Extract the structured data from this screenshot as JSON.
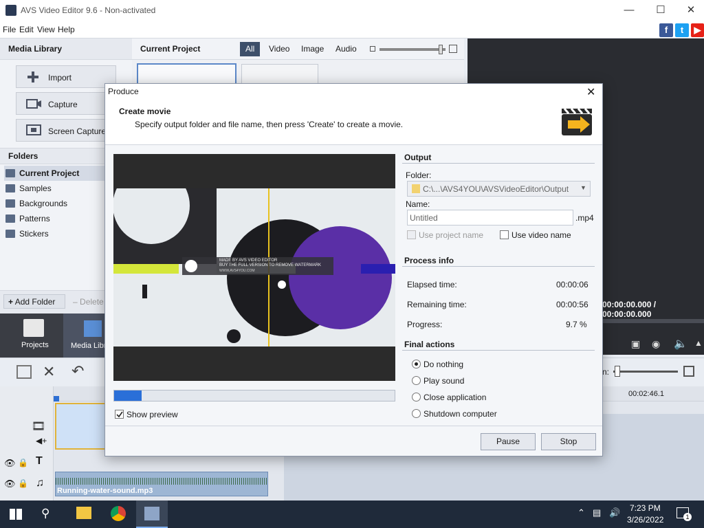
{
  "window": {
    "title": "AVS Video Editor 9.6 - Non-activated"
  },
  "menu": [
    "File",
    "Edit",
    "View",
    "Help"
  ],
  "left": {
    "media_library": "Media Library",
    "import": "Import",
    "capture": "Capture",
    "screen_capture": "Screen Capture",
    "folders": "Folders",
    "folder_items": [
      "Current Project",
      "Samples",
      "Backgrounds",
      "Patterns",
      "Stickers"
    ],
    "add_folder": "Add Folder",
    "delete": "Delete"
  },
  "center": {
    "title": "Current Project",
    "filters": [
      "All",
      "Video",
      "Image",
      "Audio"
    ]
  },
  "nav": {
    "projects": "Projects",
    "media_library": "Media Libr"
  },
  "player": {
    "time": "00:00:00.000 / 00:00:00.000",
    "zoom_label": "n:",
    "timeline_time": "00:02:46.1"
  },
  "timeline": {
    "audio_clip": "Running-water-sound.mp3"
  },
  "taskbar": {
    "time": "7:23 PM",
    "date": "3/26/2022",
    "notif_count": "1"
  },
  "dialog": {
    "title": "Produce",
    "header_title": "Create movie",
    "header_desc": "Specify output folder and file name, then press 'Create' to create a movie.",
    "progress_value": 0.097,
    "show_preview": "Show preview",
    "watermark_line1": "MADE BY AVS VIDEO EDITOR",
    "watermark_line2": "BUY THE FULL VERSION TO REMOVE WATERMARK",
    "watermark_url": "WWW.AVS4YOU.COM",
    "output": {
      "header": "Output",
      "folder_label": "Folder:",
      "folder_value": "C:\\...\\AVS4YOU\\AVSVideoEditor\\Output",
      "name_label": "Name:",
      "name_value": "Untitled",
      "ext": ".mp4",
      "use_project_name": "Use project name",
      "use_video_name": "Use video name"
    },
    "process": {
      "header": "Process info",
      "elapsed_label": "Elapsed time:",
      "elapsed": "00:00:06",
      "remaining_label": "Remaining time:",
      "remaining": "00:00:56",
      "progress_label": "Progress:",
      "progress": "9.7 %"
    },
    "final": {
      "header": "Final actions",
      "options": [
        "Do nothing",
        "Play sound",
        "Close application",
        "Shutdown computer"
      ]
    },
    "pause": "Pause",
    "stop": "Stop"
  }
}
